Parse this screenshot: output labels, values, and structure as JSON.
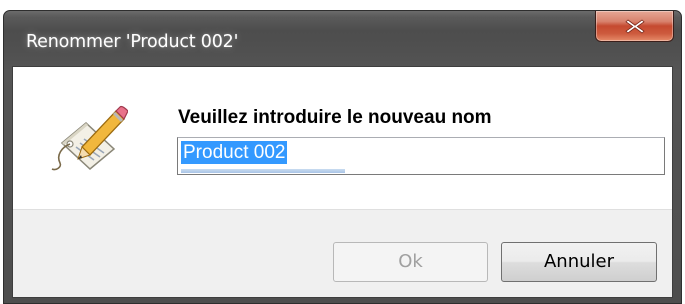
{
  "dialog": {
    "title": "Renommer 'Product 002'",
    "close_icon": "close-x-icon",
    "prompt": "Veuillez introduire le nouveau nom",
    "edit_icon": "rename-edit-icon",
    "input": {
      "value": "Product 002",
      "selected": true
    },
    "buttons": {
      "ok_label": "Ok",
      "ok_enabled": false,
      "cancel_label": "Annuler"
    }
  },
  "colors": {
    "title_text": "#ffffff",
    "close_button": "#c54a30",
    "selection": "#3399ff",
    "client_bg": "#f0f0f0",
    "content_bg": "#ffffff"
  }
}
